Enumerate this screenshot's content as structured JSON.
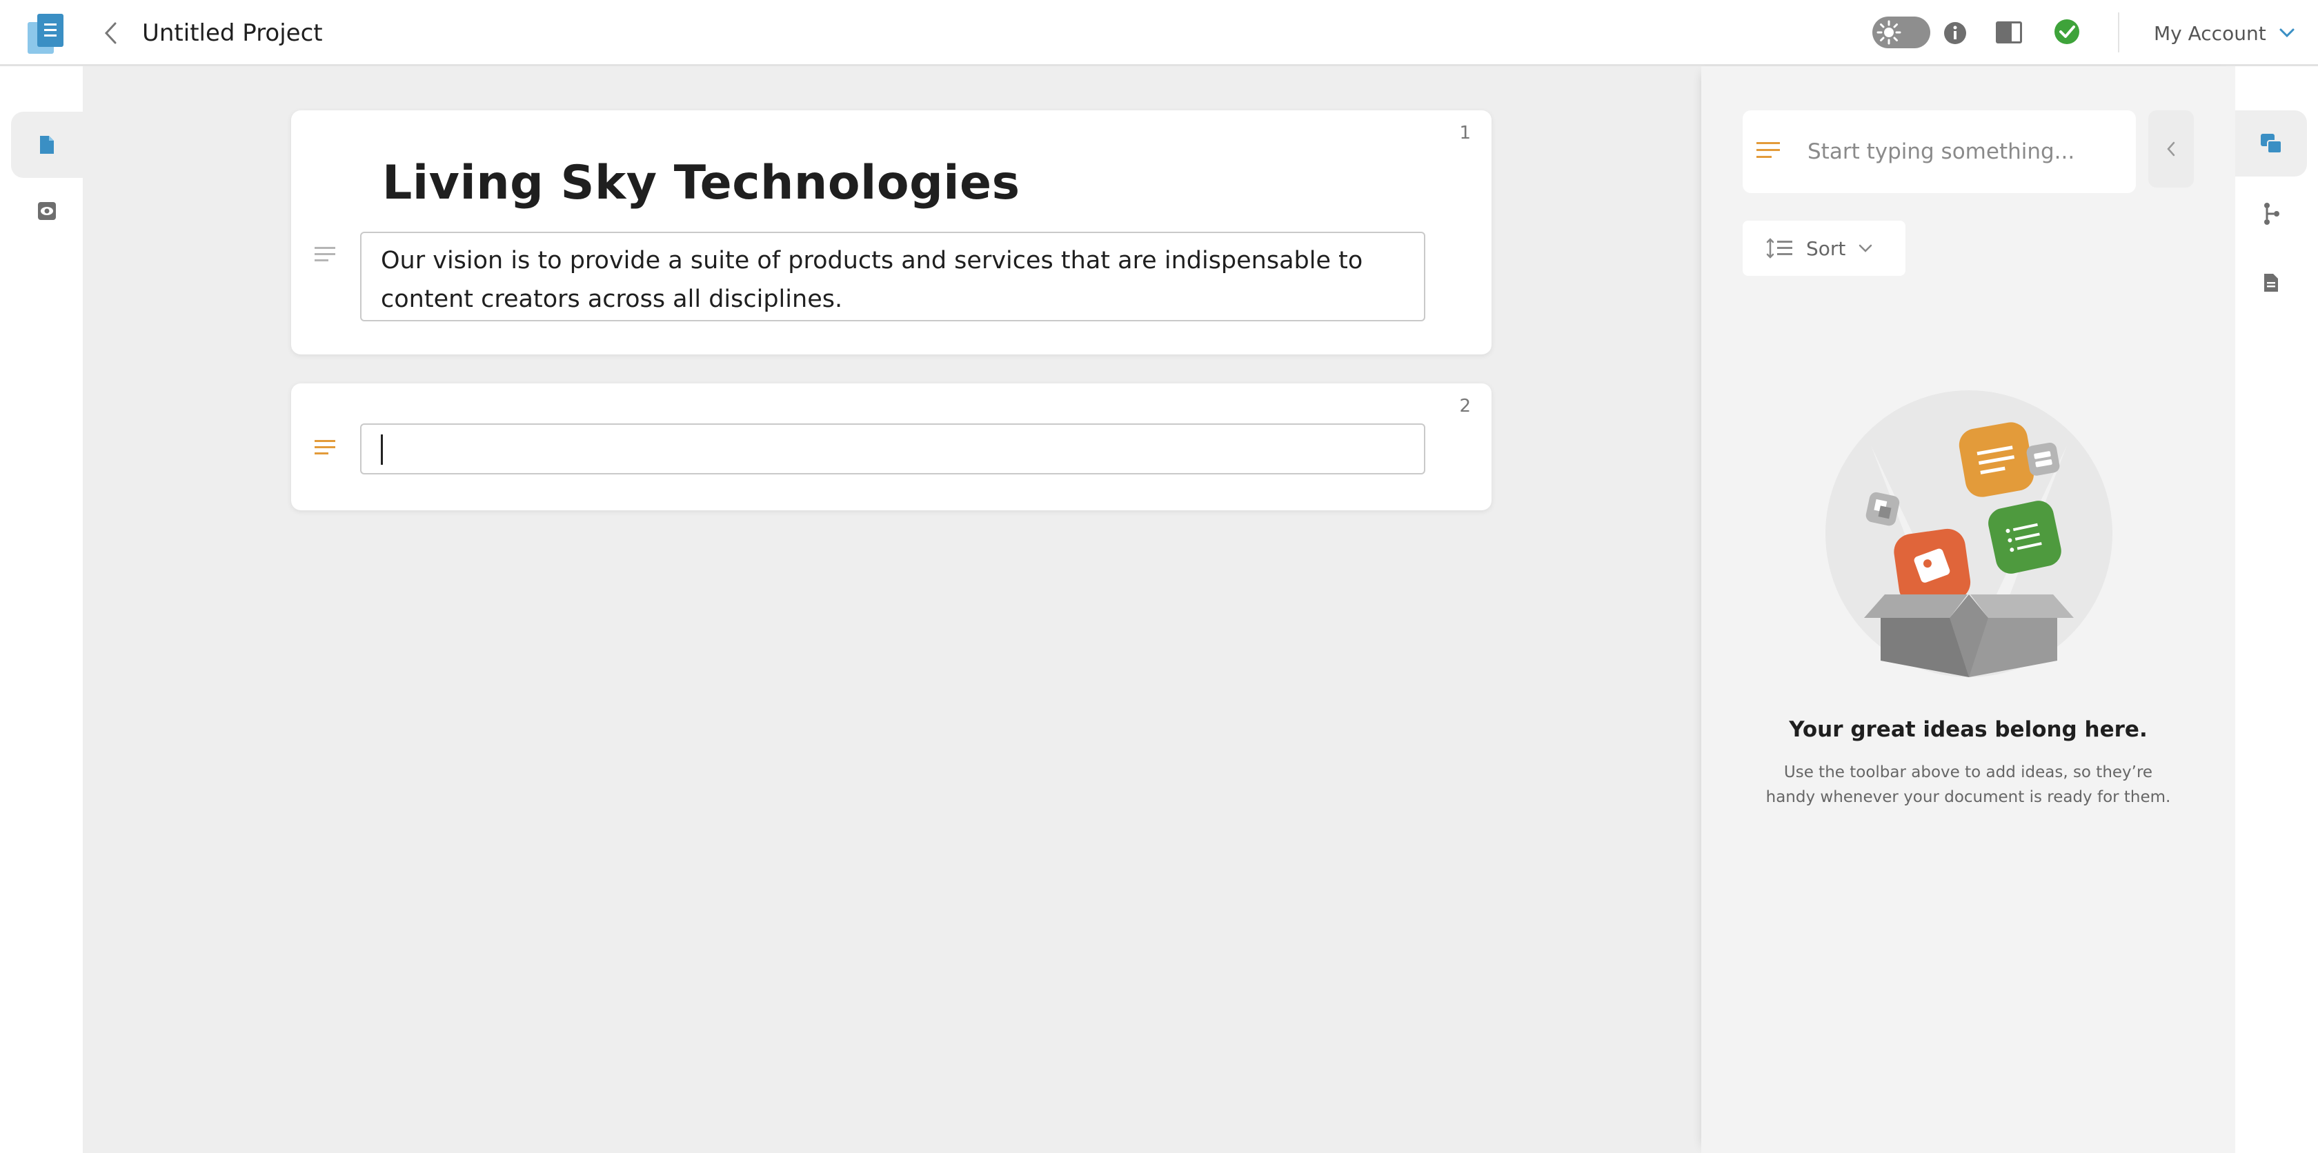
{
  "app": {
    "logo_icon": "app-logo-icon",
    "project_title": "Untitled Project",
    "accent_color": "#3a8fc4",
    "idea_accent_color": "#e39b3a"
  },
  "header": {
    "back_icon": "chevron-left-icon",
    "theme_toggle_icon": "sun-icon",
    "info_icon": "info-icon",
    "layout_icon": "split-layout-icon",
    "status_icon": "check-circle-icon",
    "status_color": "#3ea33a",
    "account_label": "My Account",
    "account_icon": "chevron-down-icon"
  },
  "left_rail": {
    "items": [
      {
        "icon": "document-icon",
        "active": true
      },
      {
        "icon": "preview-eye-icon",
        "active": false
      }
    ]
  },
  "editor": {
    "blocks": [
      {
        "number": "1",
        "heading": "Living Sky Technologies",
        "text": "Our vision is to provide a suite of products and services that are indispensable to content creators across all disciplines."
      },
      {
        "number": "2",
        "text": ""
      }
    ]
  },
  "ideas": {
    "input_placeholder": "Start typing something...",
    "collapse_icon": "chevron-left-icon",
    "sort_label": "Sort",
    "sort_icon": "sort-lines-icon",
    "sort_chevron": "chevron-down-icon",
    "empty_title": "Your great ideas belong here.",
    "empty_description": "Use the toolbar above to add ideas, so they’re handy whenever your document is ready for them."
  },
  "right_rail": {
    "items": [
      {
        "icon": "ideas-stack-icon",
        "active": true
      },
      {
        "icon": "branch-icon",
        "active": false
      },
      {
        "icon": "document-icon",
        "active": false
      }
    ]
  }
}
